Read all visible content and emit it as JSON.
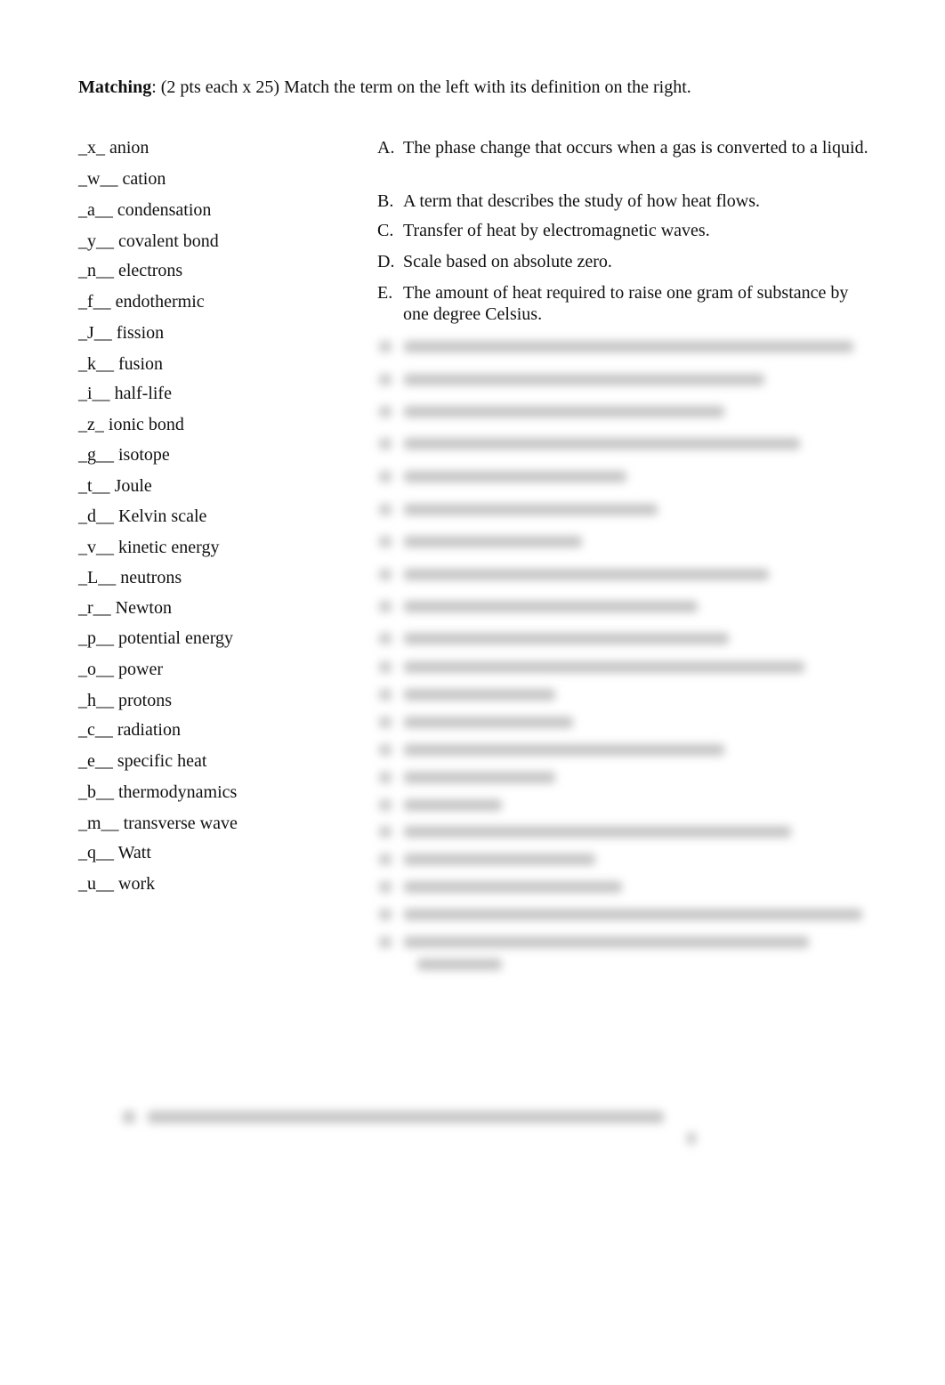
{
  "header": {
    "bold_label": "Matching",
    "rest": ":  (2 pts each x 25) Match the term on the left with its definition on the right."
  },
  "terms": [
    {
      "answer": "_x_",
      "term": "anion",
      "highlighted": false
    },
    {
      "answer": "_w__",
      "term": "cation",
      "highlighted": true
    },
    {
      "answer": "_a__",
      "term": "condensation",
      "highlighted": false
    },
    {
      "answer": "_y__",
      "term": "covalent bond",
      "highlighted": true
    },
    {
      "answer": "_n__",
      "term": "electrons",
      "highlighted": false
    },
    {
      "answer": "_f__",
      "term": "endothermic",
      "highlighted": false
    },
    {
      "answer": "_J__",
      "term": "fission",
      "highlighted": false
    },
    {
      "answer": "_k__",
      "term": "fusion",
      "highlighted": false
    },
    {
      "answer": "_i__",
      "term": "half-life",
      "highlighted": true
    },
    {
      "answer": "_z_",
      "term": "ionic bond",
      "highlighted": true
    },
    {
      "answer": "_g__",
      "term": "isotope",
      "highlighted": false
    },
    {
      "answer": "_t__",
      "term": "Joule",
      "highlighted": true
    },
    {
      "answer": "_d__",
      "term": "Kelvin scale",
      "highlighted": false
    },
    {
      "answer": "_v__",
      "term": "kinetic energy",
      "highlighted": false
    },
    {
      "answer": "_L__",
      "term": "neutrons",
      "highlighted": true
    },
    {
      "answer": "_r__",
      "term": "Newton",
      "highlighted": true
    },
    {
      "answer": "_p__",
      "term": "potential energy",
      "highlighted": false
    },
    {
      "answer": "_o__",
      "term": "power",
      "highlighted": true
    },
    {
      "answer": "_h__",
      "term": "protons",
      "highlighted": true
    },
    {
      "answer": "_c__",
      "term": "radiation",
      "highlighted": false
    },
    {
      "answer": "_e__",
      "term": "specific heat",
      "highlighted": false
    },
    {
      "answer": "_b__",
      "term": "thermodynamics",
      "highlighted": false
    },
    {
      "answer": "_m__",
      "term": "transverse wave",
      "highlighted": false
    },
    {
      "answer": "_q__",
      "term": "Watt",
      "highlighted": false
    },
    {
      "answer": "_u__",
      "term": "work",
      "highlighted": true
    }
  ],
  "definitions": [
    {
      "letter": "A.",
      "text": "The phase change that occurs when a gas is converted to a liquid."
    },
    {
      "letter": "B.",
      "text": "A term that describes the study of how heat flows."
    },
    {
      "letter": "C.",
      "text": "Transfer of heat by electromagnetic waves."
    },
    {
      "letter": "D.",
      "text": "Scale based on absolute zero."
    },
    {
      "letter": "E.",
      "text": "The amount of heat required to raise one gram of substance by one degree Celsius."
    }
  ],
  "blurred_definitions_count": 21,
  "highlight_color": "#ffff00"
}
